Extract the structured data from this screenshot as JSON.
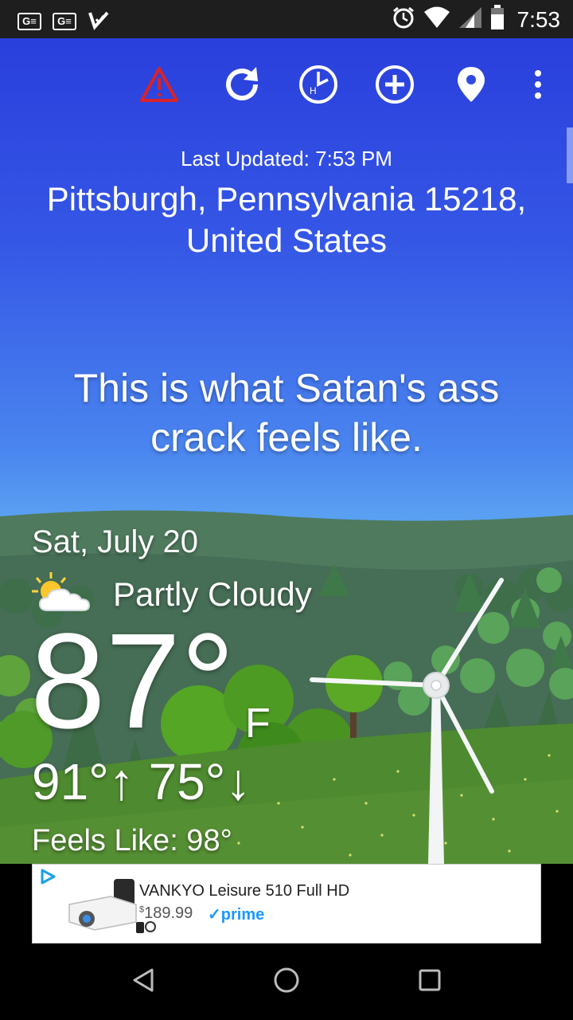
{
  "status_bar": {
    "time": "7:53",
    "left_icons": [
      "ge-icon",
      "ge-icon",
      "check-icon"
    ],
    "ge_label": "G≡",
    "right_icons": [
      "alarm-icon",
      "wifi-icon",
      "signal-icon",
      "battery-icon"
    ]
  },
  "toolbar": {
    "icons": [
      "alert-icon",
      "refresh-icon",
      "hourly-icon",
      "add-icon",
      "location-pin-icon",
      "more-vert-icon"
    ],
    "hourly_letter": "H",
    "colors": {
      "alert": "#d8232a",
      "icon": "#ffffff"
    }
  },
  "weather": {
    "last_updated": "Last Updated: 7:53 PM",
    "location": "Pittsburgh, Pennsylvania 15218, United States",
    "phrase": "This is what Satan's ass crack feels like.",
    "date": "Sat, July 20",
    "condition_icon": "partly-cloudy-icon",
    "condition": "Partly Cloudy",
    "temperature": "87°",
    "unit": "F",
    "hi_lo": "91°↑ 75°↓",
    "feels_like": "Feels Like: 98°"
  },
  "ad": {
    "choices_icon": "ad-choices-icon",
    "title": "VANKYO Leisure 510 Full HD",
    "price_currency": "$",
    "price": "189.99",
    "prime_label": "✓prime",
    "colors": {
      "prime": "#1a98ff"
    }
  },
  "nav_bar": {
    "icons": [
      "back-icon",
      "home-icon",
      "recents-icon"
    ]
  }
}
